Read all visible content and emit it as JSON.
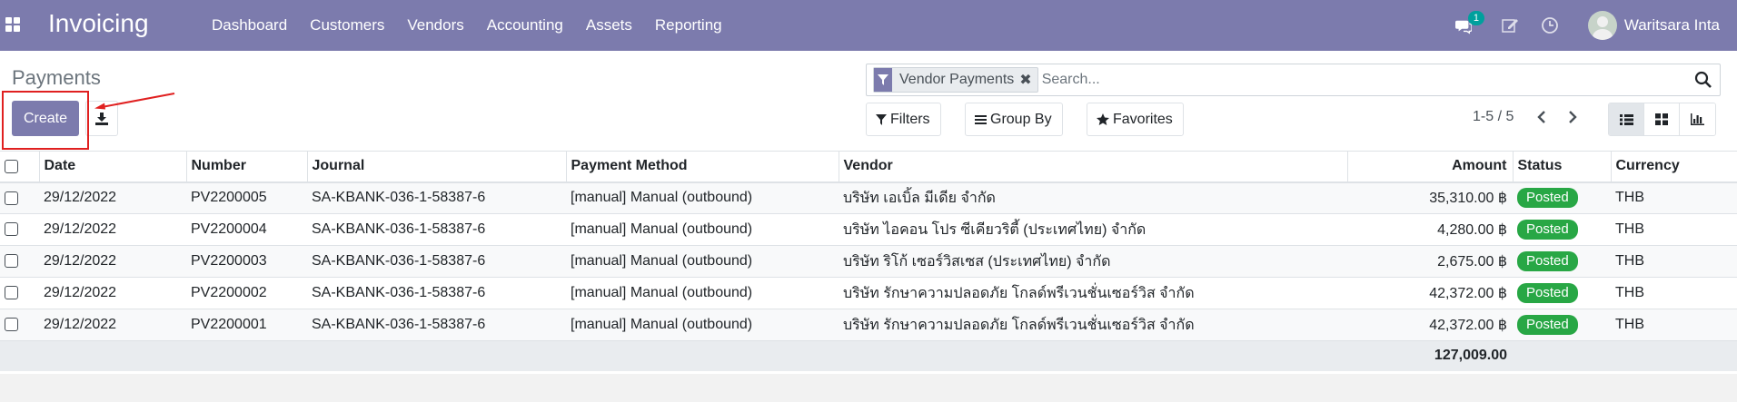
{
  "navbar": {
    "app_name": "Invoicing",
    "menu": [
      "Dashboard",
      "Customers",
      "Vendors",
      "Accounting",
      "Assets",
      "Reporting"
    ],
    "chat_count": "1",
    "user_name": "Waritsara Inta"
  },
  "control": {
    "breadcrumb": "Payments",
    "create_label": "Create",
    "search": {
      "facet_label": "Vendor Payments",
      "placeholder": "Search..."
    },
    "filters_label": "Filters",
    "groupby_label": "Group By",
    "favorites_label": "Favorites",
    "pager": "1-5 / 5"
  },
  "table": {
    "headers": [
      "Date",
      "Number",
      "Journal",
      "Payment Method",
      "Vendor",
      "Amount",
      "Status",
      "Currency"
    ],
    "rows": [
      {
        "date": "29/12/2022",
        "number": "PV2200005",
        "journal": "SA-KBANK-036-1-58387-6",
        "method": "[manual] Manual (outbound)",
        "vendor": "บริษัท เอเบิ้ล มีเดีย จำกัด",
        "amount": "35,310.00 ฿",
        "status": "Posted",
        "currency": "THB"
      },
      {
        "date": "29/12/2022",
        "number": "PV2200004",
        "journal": "SA-KBANK-036-1-58387-6",
        "method": "[manual] Manual (outbound)",
        "vendor": "บริษัท ไอคอน โปร ซีเคียวริตี้ (ประเทศไทย) จำกัด",
        "amount": "4,280.00 ฿",
        "status": "Posted",
        "currency": "THB"
      },
      {
        "date": "29/12/2022",
        "number": "PV2200003",
        "journal": "SA-KBANK-036-1-58387-6",
        "method": "[manual] Manual (outbound)",
        "vendor": "บริษัท ริโก้ เซอร์วิสเซส (ประเทศไทย) จำกัด",
        "amount": "2,675.00 ฿",
        "status": "Posted",
        "currency": "THB"
      },
      {
        "date": "29/12/2022",
        "number": "PV2200002",
        "journal": "SA-KBANK-036-1-58387-6",
        "method": "[manual] Manual (outbound)",
        "vendor": "บริษัท รักษาความปลอดภัย โกลด์พรีเวนชั่นเซอร์วิส จำกัด",
        "amount": "42,372.00 ฿",
        "status": "Posted",
        "currency": "THB"
      },
      {
        "date": "29/12/2022",
        "number": "PV2200001",
        "journal": "SA-KBANK-036-1-58387-6",
        "method": "[manual] Manual (outbound)",
        "vendor": "บริษัท รักษาความปลอดภัย โกลด์พรีเวนชั่นเซอร์วิส จำกัด",
        "amount": "42,372.00 ฿",
        "status": "Posted",
        "currency": "THB"
      }
    ],
    "total": "127,009.00"
  },
  "colors": {
    "brand": "#7c7bad",
    "status_posted": "#28a745",
    "chat_badge": "#00a09d",
    "annotation": "#e02020"
  }
}
